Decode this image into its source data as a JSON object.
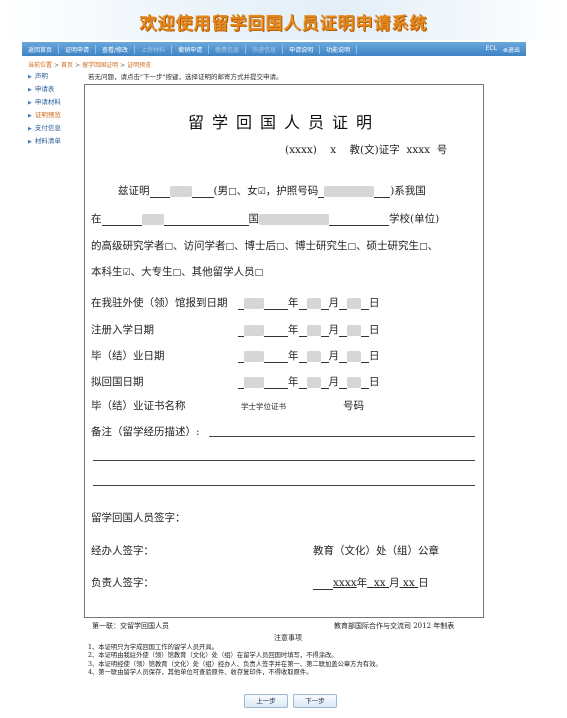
{
  "banner": {
    "title": "欢迎使用留学回国人员证明申请系统"
  },
  "nav": {
    "items": [
      "返回首页",
      "证明申请",
      "查看/修改",
      "上传材料",
      "撤销申请",
      "缴费信息",
      "快递信息",
      "申请说明",
      "功能说明"
    ],
    "right": [
      "ECL",
      "退出"
    ]
  },
  "breadcrumb": [
    "当前位置",
    "首页",
    "留学回国证明",
    "证明预览"
  ],
  "sidebar": {
    "items": [
      "声明",
      "申请表",
      "申请材料",
      "证明预览",
      "支付信息",
      "材料清单"
    ],
    "active_index": 3
  },
  "instructions": "若无问题，请点击\"下一步\"按键，选择证明的邮寄方式并提交申请。",
  "certificate": {
    "title": "留学回国人员证明",
    "number_line": {
      "prefix": "(xxxx)",
      "x": "x",
      "label": "教(文)证字",
      "num": "xxxx",
      "suffix": "号"
    },
    "line1": {
      "a": "兹证明",
      "b": "(男",
      "c": "、女",
      "d": "，护照号码",
      "e": ")系我国"
    },
    "line2": {
      "a": "在",
      "b": "国",
      "c": "学校(单位)"
    },
    "line3": {
      "a": "的高级研究学者",
      "b": "、访问学者",
      "c": "、博士后",
      "d": "、博士研究生",
      "e": "、硕士研究生",
      "f": "、"
    },
    "line4": {
      "a": "本科生",
      "b": "、大专生",
      "c": "、其他留学人员"
    },
    "date_rows": [
      {
        "label": "在我驻外使（领）馆报到日期"
      },
      {
        "label": "注册入学日期"
      },
      {
        "label": "毕（结）业日期"
      },
      {
        "label": "拟回国日期"
      }
    ],
    "date_units": {
      "year": "年",
      "month": "月",
      "day": "日"
    },
    "degree": {
      "label": "毕（结）业证书名称",
      "value": "学士学位证书",
      "number_label": "号码"
    },
    "remarks_label": "备注（留学经历描述）:",
    "returnee_sign": "留学回国人员签字：",
    "handler_sign": "经办人签字：",
    "office_seal": "教育（文化）处（组）公章",
    "supervisor_sign": "负责人签字：",
    "sign_date": {
      "year": "xxxx",
      "year_unit": "年",
      "month": "xx",
      "month_unit": "月",
      "day": "xx",
      "day_unit": "日"
    }
  },
  "footer": {
    "copy_label": "第一联：交留学回国人员",
    "issuer": "教育部国际合作与交流司 2012 年制表"
  },
  "notes": {
    "title": "注意事项",
    "items": [
      "1、本证明只为学成回国工作的留学人员开具。",
      "2、本证明由我驻外使（领）馆教育（文化）处（组）在留学人员回国时填写，不得涂改。",
      "3、本证明经使（领）馆教育（文化）处（组）经办人、负责人签字并在第一、第二联加盖公章方为有效。",
      "4、第一联由留学人员保存，其他单位可查验原件、收存复印件，不得收取原件。"
    ]
  },
  "buttons": {
    "prev": "上一步",
    "next": "下一步"
  }
}
